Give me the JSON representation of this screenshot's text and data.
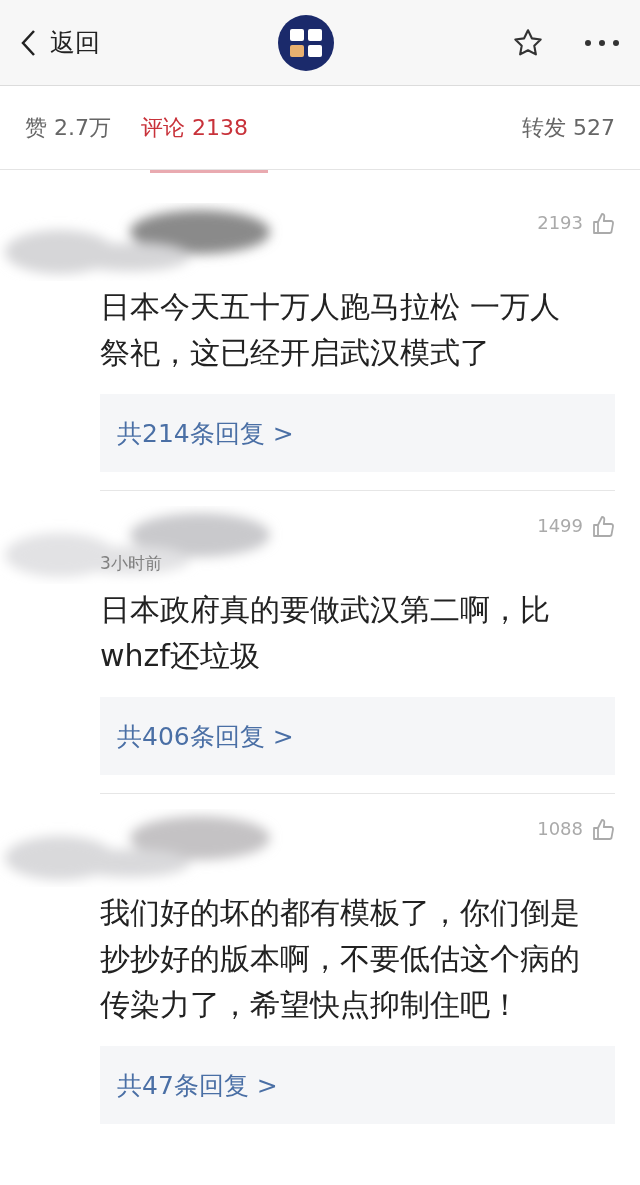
{
  "header": {
    "back_label": "返回"
  },
  "tabs": [
    {
      "label": "赞 2.7万",
      "selected": false
    },
    {
      "label": "评论 2138",
      "selected": true
    },
    {
      "label": "转发 527",
      "selected": false
    }
  ],
  "comments": [
    {
      "likes": "2193",
      "text": "日本今天五十万人跑马拉松 一万人祭祀，这已经开启武汉模式了",
      "replies": "共214条回复 >"
    },
    {
      "time": "3小时前",
      "likes": "1499",
      "text": "日本政府真的要做武汉第二啊，比whzf还垃圾",
      "replies": "共406条回复 >"
    },
    {
      "likes": "1088",
      "text": "我们好的坏的都有模板了，你们倒是抄抄好的版本啊，不要低估这个病的传染力了，希望快点抑制住吧！",
      "replies": "共47条回复 >"
    }
  ]
}
